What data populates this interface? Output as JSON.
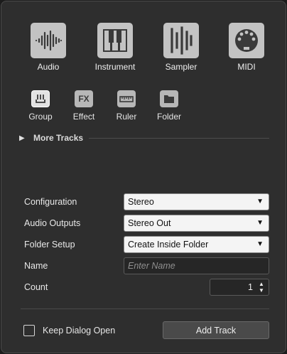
{
  "big_tracks": [
    {
      "label": "Audio",
      "icon": "waveform-icon"
    },
    {
      "label": "Instrument",
      "icon": "keyboard-icon"
    },
    {
      "label": "Sampler",
      "icon": "sampler-icon"
    },
    {
      "label": "MIDI",
      "icon": "midi-connector-icon"
    }
  ],
  "small_tracks": [
    {
      "label": "Group",
      "icon": "group-channel-icon",
      "active": true
    },
    {
      "label": "Effect",
      "icon": "fx-icon",
      "icon_text": "FX"
    },
    {
      "label": "Ruler",
      "icon": "ruler-icon"
    },
    {
      "label": "Folder",
      "icon": "folder-icon"
    }
  ],
  "more_tracks": {
    "label": "More Tracks",
    "arrow": "▶"
  },
  "form": {
    "configuration": {
      "label": "Configuration",
      "value": "Stereo"
    },
    "audio_outputs": {
      "label": "Audio Outputs",
      "value": "Stereo Out"
    },
    "folder_setup": {
      "label": "Folder Setup",
      "value": "Create Inside Folder"
    },
    "name": {
      "label": "Name",
      "placeholder": "Enter Name",
      "value": ""
    },
    "count": {
      "label": "Count",
      "value": "1"
    }
  },
  "keep_dialog_open": {
    "label": "Keep Dialog Open",
    "checked": false
  },
  "add_track_button": "Add Track",
  "colors": {
    "dialog_bg": "#2e2e2e",
    "icon_bg": "#c3c3c3",
    "dropdown_bg": "#f4f4f4"
  }
}
